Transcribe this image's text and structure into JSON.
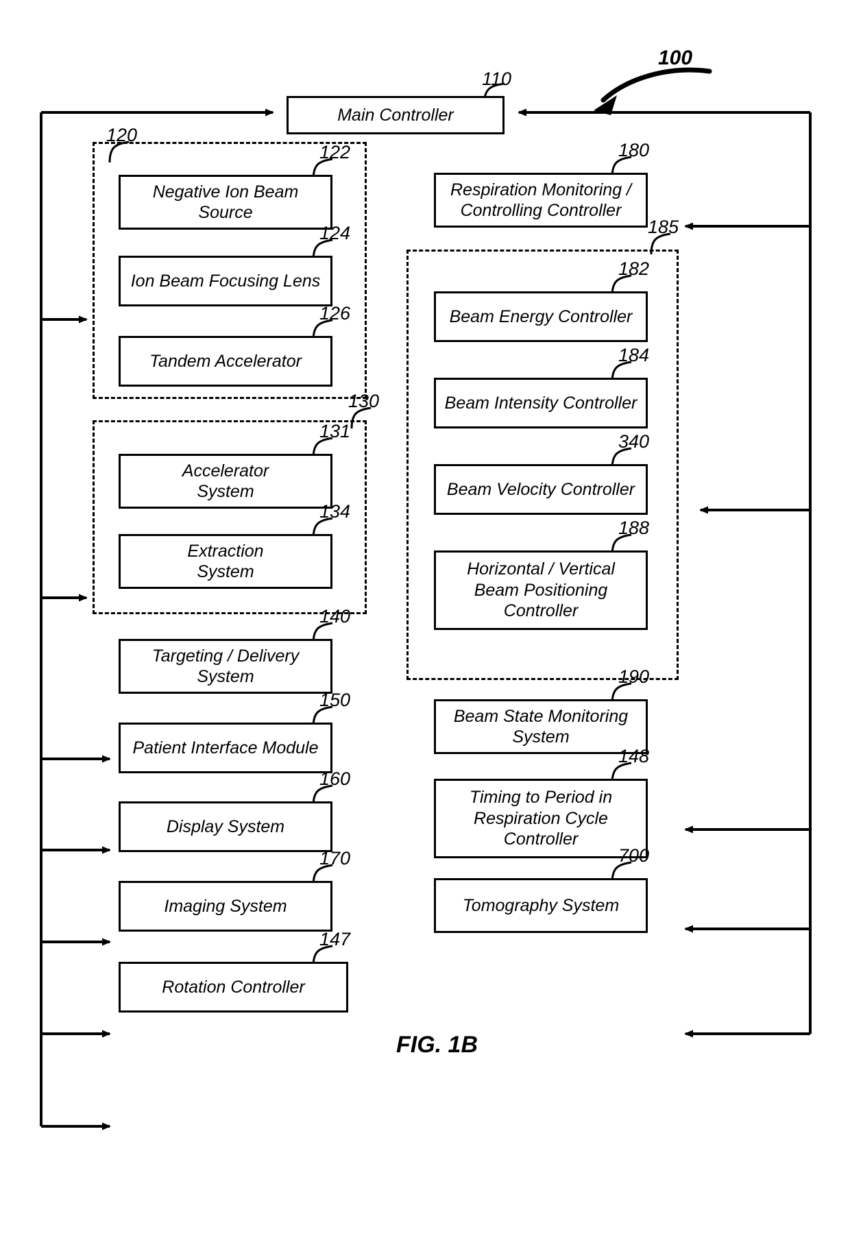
{
  "figure": {
    "caption": "FIG. 1B",
    "system_ref": "100"
  },
  "nodes": {
    "main_controller": {
      "label": "Main Controller",
      "ref": "110"
    },
    "negative_ion_beam_source": {
      "label": "Negative Ion Beam\nSource",
      "ref": "122"
    },
    "ion_beam_focusing_lens": {
      "label": "Ion Beam Focusing Lens",
      "ref": "124"
    },
    "tandem_accelerator": {
      "label": "Tandem Accelerator",
      "ref": "126"
    },
    "accelerator_system": {
      "label": "Accelerator\nSystem",
      "ref": "131"
    },
    "extraction_system": {
      "label": "Extraction\nSystem",
      "ref": "134"
    },
    "targeting_delivery_system": {
      "label": "Targeting / Delivery\nSystem",
      "ref": "140"
    },
    "patient_interface_module": {
      "label": "Patient Interface Module",
      "ref": "150"
    },
    "display_system": {
      "label": "Display System",
      "ref": "160"
    },
    "imaging_system": {
      "label": "Imaging System",
      "ref": "170"
    },
    "rotation_controller": {
      "label": "Rotation Controller",
      "ref": "147"
    },
    "respiration_monitoring_controller": {
      "label": "Respiration Monitoring /\nControlling Controller",
      "ref": "180"
    },
    "beam_energy_controller": {
      "label": "Beam Energy Controller",
      "ref": "182"
    },
    "beam_intensity_controller": {
      "label": "Beam Intensity Controller",
      "ref": "184"
    },
    "beam_velocity_controller": {
      "label": "Beam Velocity Controller",
      "ref": "340"
    },
    "horizontal_vertical_beam_positioning_controller": {
      "label": "Horizontal / Vertical\nBeam Positioning\nController",
      "ref": "188"
    },
    "beam_state_monitoring_system": {
      "label": "Beam State Monitoring\nSystem",
      "ref": "190"
    },
    "timing_to_period_controller": {
      "label": "Timing to Period in\nRespiration Cycle\nController",
      "ref": "148"
    },
    "tomography_system": {
      "label": "Tomography System",
      "ref": "700"
    }
  },
  "groups": {
    "injection_group": {
      "ref": "120"
    },
    "synchrotron_group": {
      "ref": "130"
    },
    "beam_control_group": {
      "ref": "185"
    }
  }
}
